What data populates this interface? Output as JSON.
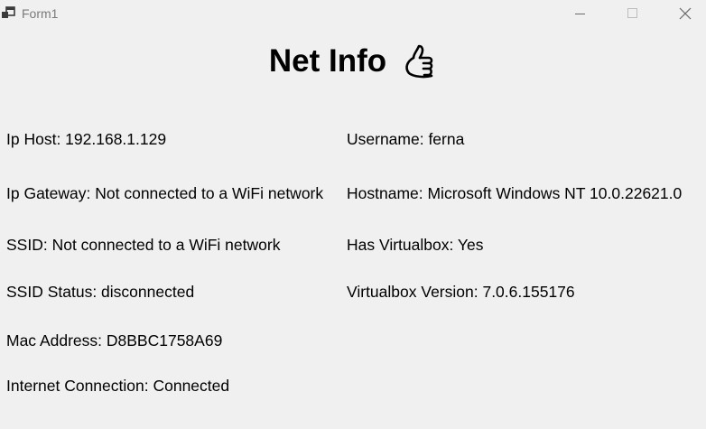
{
  "window": {
    "title": "Form1",
    "icon": "app-icon",
    "controls": [
      "minimize-icon",
      "maximize-icon",
      "close-icon"
    ]
  },
  "heading": {
    "text": "Net Info",
    "icon": "thumbs-up-icon"
  },
  "fields": {
    "ip_host": "Ip Host:  192.168.1.129",
    "ip_gateway": "Ip Gateway: Not connected to a WiFi network",
    "ssid": "SSID: Not connected to a WiFi network",
    "ssid_status": "SSID Status: disconnected",
    "mac_address": "Mac Address: D8BBC1758A69",
    "internet_connection": "Internet Connection: Connected",
    "username": "Username:  ferna",
    "hostname": "Hostname: Microsoft Windows NT 10.0.22621.0",
    "has_virtualbox": "Has Virtualbox:  Yes",
    "virtualbox_version": "Virtualbox Version: 7.0.6.155176"
  }
}
